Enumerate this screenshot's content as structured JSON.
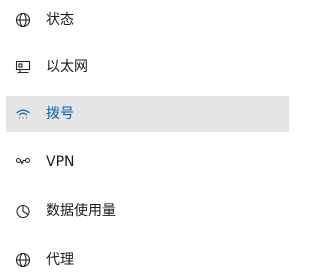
{
  "nav": {
    "items": [
      {
        "label": "状态",
        "icon": "globe-icon",
        "selected": false
      },
      {
        "label": "以太网",
        "icon": "ethernet-icon",
        "selected": false
      },
      {
        "label": "拨号",
        "icon": "dialup-icon",
        "selected": true
      },
      {
        "label": "VPN",
        "icon": "vpn-icon",
        "selected": false
      },
      {
        "label": "数据使用量",
        "icon": "data-usage-icon",
        "selected": false
      },
      {
        "label": "代理",
        "icon": "globe-icon",
        "selected": false
      }
    ]
  },
  "colors": {
    "selected_background": "#e5e5e5",
    "selected_text": "#0063b1",
    "text": "#1a1a1a",
    "icon": "#262626"
  }
}
